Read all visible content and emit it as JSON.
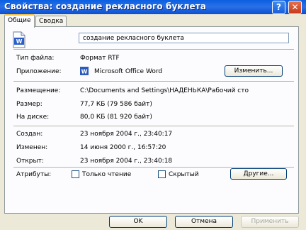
{
  "window": {
    "title": "Свойства: создание рекласного буклета"
  },
  "tabs": [
    {
      "label": "Общие",
      "active": true
    },
    {
      "label": "Сводка",
      "active": false
    }
  ],
  "general": {
    "file_name": "создание рекласного буклета",
    "file_type_label": "Тип файла:",
    "file_type_value": "Формат RTF",
    "app_label": "Приложение:",
    "app_value": "Microsoft Office Word",
    "change_button": "Изменить...",
    "location_label": "Размещение:",
    "location_value": "C:\\Documents and Settings\\НАДЕНЬКА\\Рабочий сто",
    "size_label": "Размер:",
    "size_value": "77,7 КБ (79 586 байт)",
    "disk_label": "На диске:",
    "disk_value": "80,0 КБ (81 920 байт)",
    "created_label": "Создан:",
    "created_value": "23 ноября 2004 г., 23:40:17",
    "modified_label": "Изменен:",
    "modified_value": "14 июня 2000 г., 16:57:20",
    "opened_label": "Открыт:",
    "opened_value": "23 ноября 2004 г., 23:40:18",
    "attributes_label": "Атрибуты:",
    "readonly_label": "Только чтение",
    "hidden_label": "Скрытый",
    "other_button": "Другие..."
  },
  "footer": {
    "ok": "OK",
    "cancel": "Отмена",
    "apply": "Применить"
  }
}
